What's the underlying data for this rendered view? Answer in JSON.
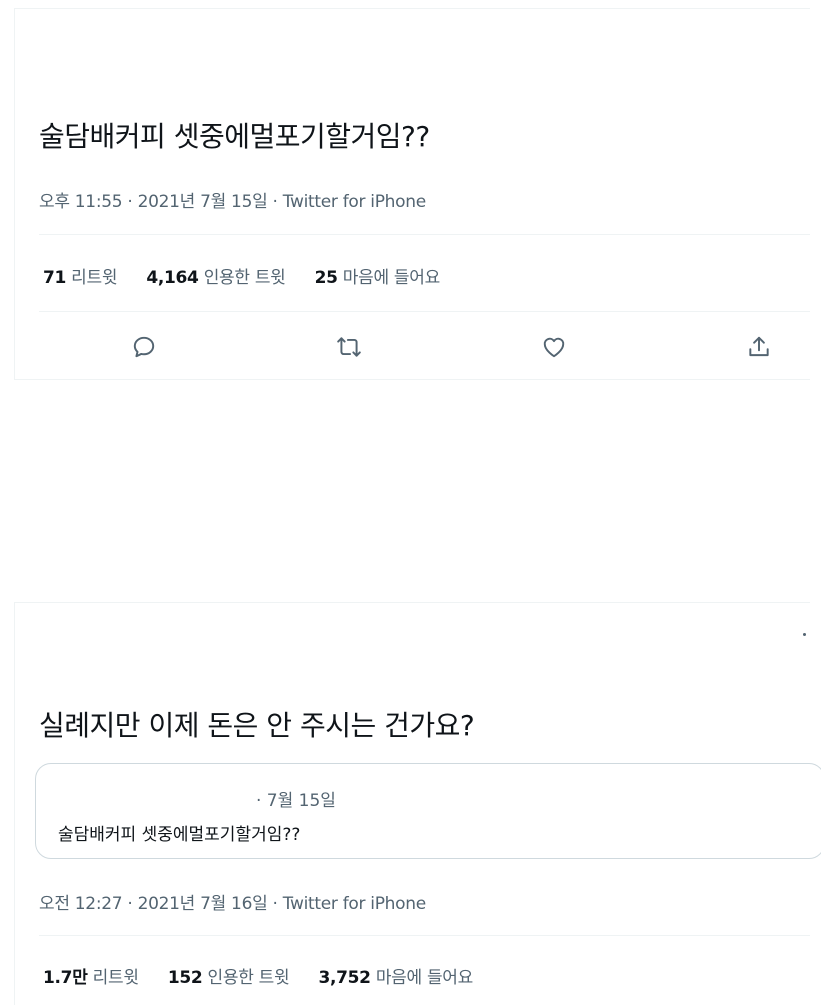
{
  "tweet1": {
    "text": "술담배커피 셋중에멀포기할거임??",
    "meta": "오후 11:55 · 2021년 7월 15일 · Twitter for iPhone",
    "stats": [
      {
        "num": "71",
        "label": "리트윗"
      },
      {
        "num": "4,164",
        "label": "인용한 트윗"
      },
      {
        "num": "25",
        "label": "마음에 들어요"
      }
    ],
    "actions": [
      "reply-icon",
      "retweet-icon",
      "like-icon",
      "share-icon"
    ]
  },
  "tweet2": {
    "text": "실례지만 이제 돈은 안 주시는 건가요?",
    "quote": {
      "date": "· 7월 15일",
      "text": "술담배커피 셋중에멀포기할거임??"
    },
    "meta": "오전 12:27 · 2021년 7월 16일 · Twitter for iPhone",
    "stats": [
      {
        "num": "1.7만",
        "label": "리트윗"
      },
      {
        "num": "152",
        "label": "인용한 트윗"
      },
      {
        "num": "3,752",
        "label": "마음에 들어요"
      }
    ]
  },
  "colors": {
    "text_primary": "#0f1419",
    "text_secondary": "#536471",
    "border": "#eff3f4"
  }
}
